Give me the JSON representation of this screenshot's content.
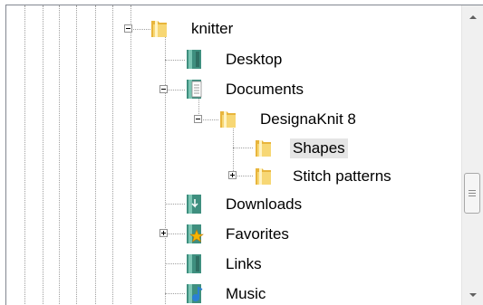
{
  "tree": {
    "nodes": [
      {
        "label": "knitter",
        "icon": "folder-icon",
        "expander": "collapse"
      },
      {
        "label": "Desktop",
        "icon": "desktop-folder-icon"
      },
      {
        "label": "Documents",
        "icon": "documents-folder-icon",
        "expander": "collapse"
      },
      {
        "label": "DesignaKnit 8",
        "icon": "folder-icon",
        "expander": "collapse"
      },
      {
        "label": "Shapes",
        "icon": "folder-icon",
        "selected": true
      },
      {
        "label": "Stitch patterns",
        "icon": "folder-icon",
        "expander": "expand"
      },
      {
        "label": "Downloads",
        "icon": "downloads-folder-icon"
      },
      {
        "label": "Favorites",
        "icon": "favorites-folder-icon",
        "expander": "expand"
      },
      {
        "label": "Links",
        "icon": "links-folder-icon"
      },
      {
        "label": "Music",
        "icon": "music-folder-icon"
      }
    ]
  },
  "colors": {
    "folder": "#f2c94c",
    "special_folder": "#3f8f7f",
    "selection": "#e5e5e5",
    "border": "#828790"
  }
}
